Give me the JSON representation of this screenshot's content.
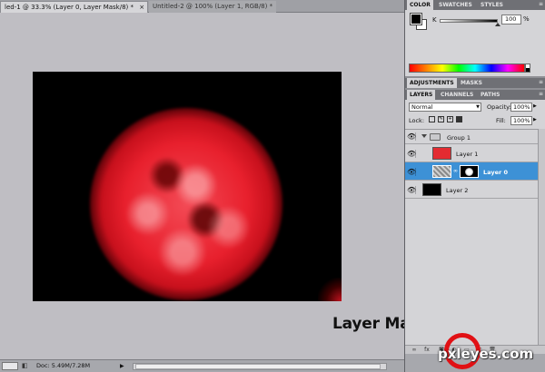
{
  "document": {
    "tabs": [
      {
        "label": "led-1 @ 33.3% (Layer 0, Layer Mask/8) *",
        "close": "×"
      },
      {
        "label": "Untitled-2 @ 100% (Layer 1, RGB/8) *",
        "close": "×"
      }
    ],
    "annotation": "Layer Mask Button",
    "watermark": "pxleyes.com",
    "status": {
      "doc": "Doc: 5.49M/7.28M",
      "arrow": "▶"
    }
  },
  "panels": {
    "color": {
      "tabs": [
        "COLOR",
        "SWATCHES",
        "STYLES"
      ],
      "channel_label": "K",
      "channel_value": "100",
      "channel_unit": "%"
    },
    "adjustments": {
      "tabs": [
        "ADJUSTMENTS",
        "MASKS"
      ]
    },
    "layers": {
      "tabs": [
        "LAYERS",
        "CHANNELS",
        "PATHS"
      ],
      "blend_mode": "Normal",
      "opacity_label": "Opacity:",
      "opacity_value": "100%",
      "lock_label": "Lock:",
      "fill_label": "Fill:",
      "fill_value": "100%",
      "items": [
        {
          "name": "Group 1"
        },
        {
          "name": "Layer 1"
        },
        {
          "name": "Layer 0"
        },
        {
          "name": "Layer 2"
        }
      ]
    }
  },
  "colors": {
    "selected_layer": "#3d91d6",
    "annotation_circle": "#e11014",
    "glow": "#e8202d"
  }
}
